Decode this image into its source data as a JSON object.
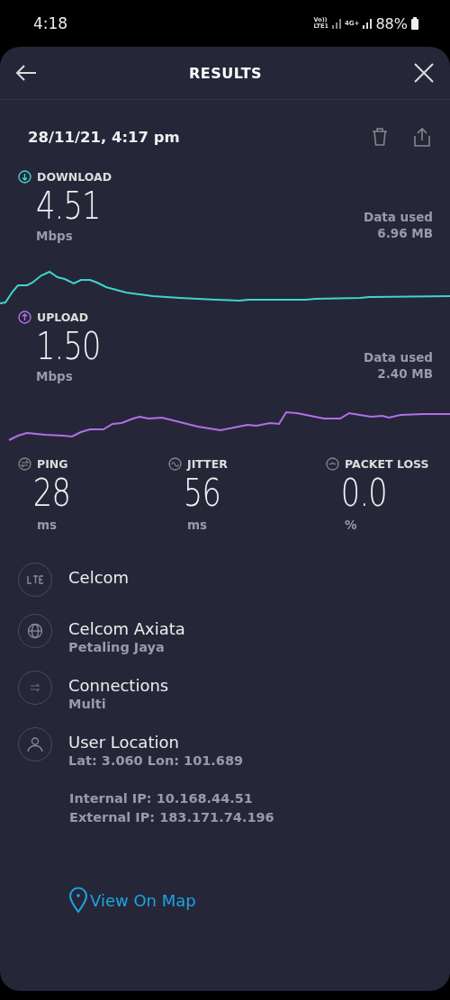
{
  "status_bar": {
    "time": "4:18",
    "sim1_label": "Vo))",
    "sim1_network": "LTE1",
    "sim2_network": "4G+",
    "battery": "88%"
  },
  "header": {
    "title": "RESULTS"
  },
  "test_time": "28/11/21, 4:17 pm",
  "speeds": [
    {
      "kind": "download",
      "label": "DOWNLOAD",
      "value": "4.51",
      "unit": "Mbps",
      "data_label": "Data used",
      "data_value": "6.96 MB",
      "color": "#3fd6c9"
    },
    {
      "kind": "upload",
      "label": "UPLOAD",
      "value": "1.50",
      "unit": "Mbps",
      "data_label": "Data used",
      "data_value": "2.40 MB",
      "color": "#b070e8"
    }
  ],
  "metrics": [
    {
      "kind": "ping",
      "label": "PING",
      "value": "28",
      "unit": "ms"
    },
    {
      "kind": "jitter",
      "label": "JITTER",
      "value": "56",
      "unit": "ms"
    },
    {
      "kind": "packet_loss",
      "label": "PACKET LOSS",
      "value": "0.0",
      "unit": "%"
    }
  ],
  "details": [
    {
      "kind": "network",
      "title": "Celcom"
    },
    {
      "kind": "provider",
      "title": "Celcom Axiata",
      "subtitle": "Petaling Jaya"
    },
    {
      "kind": "connections",
      "title": "Connections",
      "subtitle": "Multi"
    },
    {
      "kind": "location",
      "title": "User Location",
      "subtitle": "Lat: 3.060 Lon: 101.689"
    }
  ],
  "ip": {
    "internal": "Internal IP: 10.168.44.51",
    "external": "External IP: 183.171.74.196"
  },
  "map_link": "View On Map"
}
